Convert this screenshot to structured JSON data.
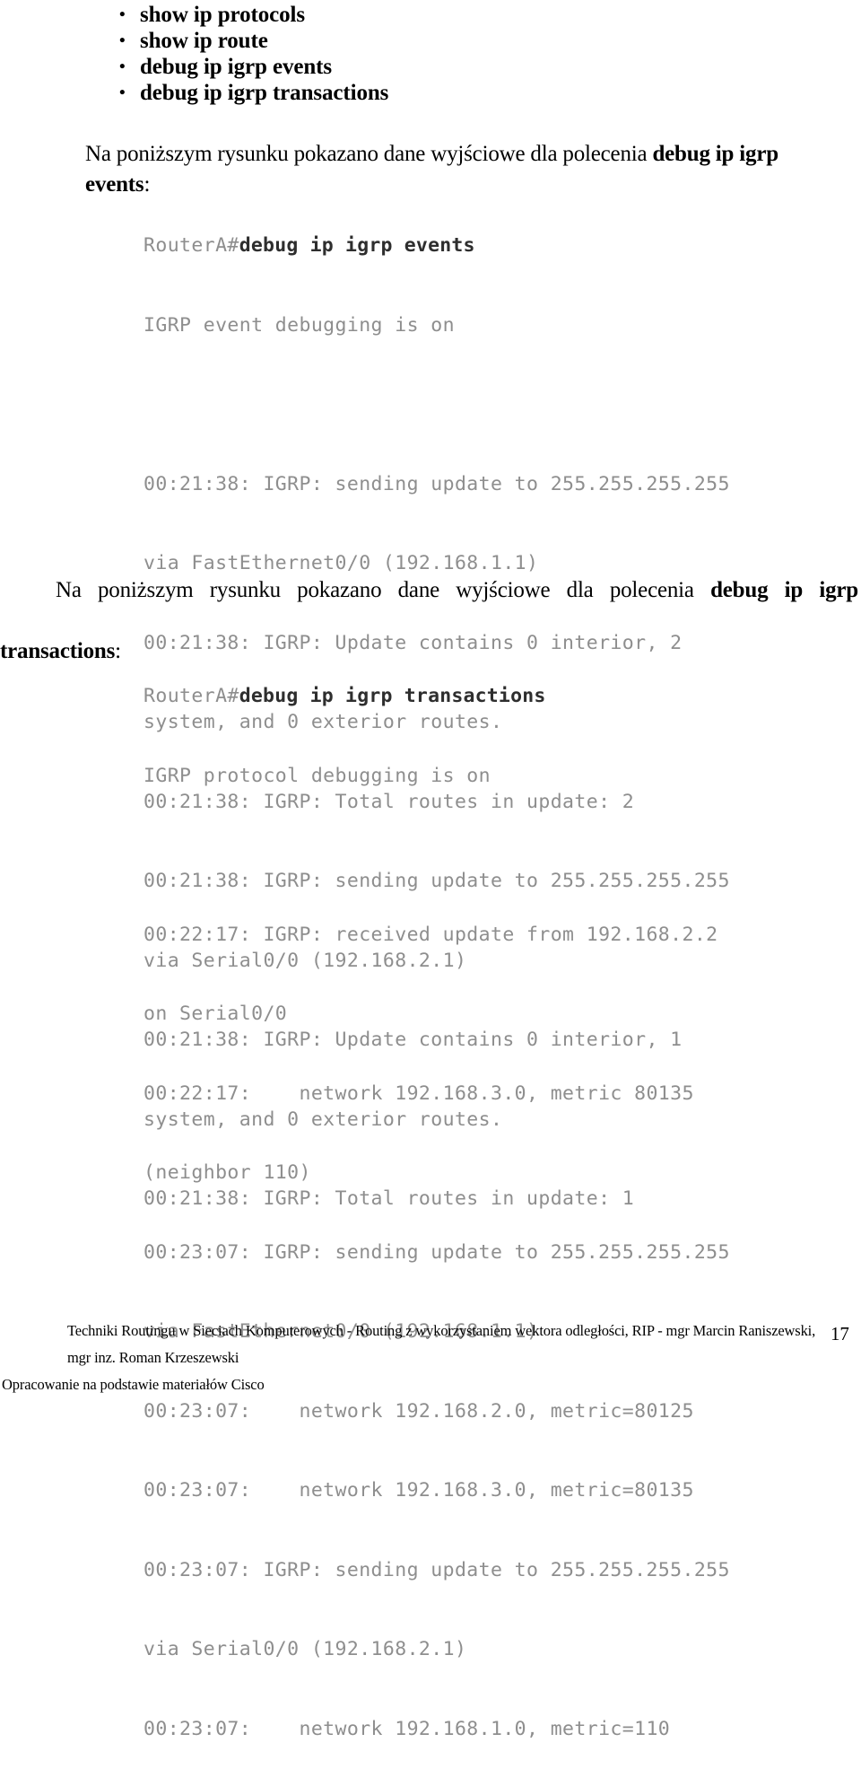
{
  "command_list": {
    "bullet_glyph": "•",
    "items": [
      "show ip protocols",
      "show ip route",
      "debug ip igrp events",
      "debug ip igrp transactions"
    ]
  },
  "paragraphs": {
    "events_intro": {
      "lead": "Na poniższym rysunku pokazano dane wyjściowe dla polecenia ",
      "command": "debug ip igrp events",
      "trail": ":"
    },
    "transactions_intro": {
      "line1_lead": "Na poniższym rysunku pokazano dane wyjściowe dla polecenia ",
      "line1_command": "debug ip igrp",
      "line2_command": "transactions",
      "line2_trail": ":"
    }
  },
  "console_events": {
    "prompt": "RouterA#",
    "command": "debug ip igrp events",
    "lines": [
      "IGRP event debugging is on",
      "",
      "00:21:38: IGRP: sending update to 255.255.255.255",
      "via FastEthernet0/0 (192.168.1.1)",
      "00:21:38: IGRP: Update contains 0 interior, 2",
      "system, and 0 exterior routes.",
      "00:21:38: IGRP: Total routes in update: 2",
      "00:21:38: IGRP: sending update to 255.255.255.255",
      "via Serial0/0 (192.168.2.1)",
      "00:21:38: IGRP: Update contains 0 interior, 1",
      "system, and 0 exterior routes.",
      "00:21:38: IGRP: Total routes in update: 1"
    ]
  },
  "console_transactions": {
    "prompt": "RouterA#",
    "command": "debug ip igrp transactions",
    "lines": [
      "IGRP protocol debugging is on",
      "",
      "00:22:17: IGRP: received update from 192.168.2.2",
      "on Serial0/0",
      "00:22:17:    network 192.168.3.0, metric 80135",
      "(neighbor 110)",
      "00:23:07: IGRP: sending update to 255.255.255.255",
      "via FastEthernet0/0 (192.168.1.1)",
      "00:23:07:    network 192.168.2.0, metric=80125",
      "00:23:07:    network 192.168.3.0, metric=80135",
      "00:23:07: IGRP: sending update to 255.255.255.255",
      "via Serial0/0 (192.168.2.1)",
      "00:23:07:    network 192.168.1.0, metric=110"
    ]
  },
  "footer": {
    "line1": "Techniki Routingu w Sieciach Komputerowych - Routing z wykorzystaniem wektora odległości, RIP - mgr Marcin Raniszewski,",
    "line2": "mgr inz. Roman Krzeszewski",
    "line3": "Opracowanie na podstawie materiałów Cisco",
    "page_number": "17"
  },
  "colors": {
    "page_background": "#ffffff",
    "body_text": "#000000",
    "console_text": "#8e8e8e",
    "console_bold_text": "#2e2e2e"
  }
}
